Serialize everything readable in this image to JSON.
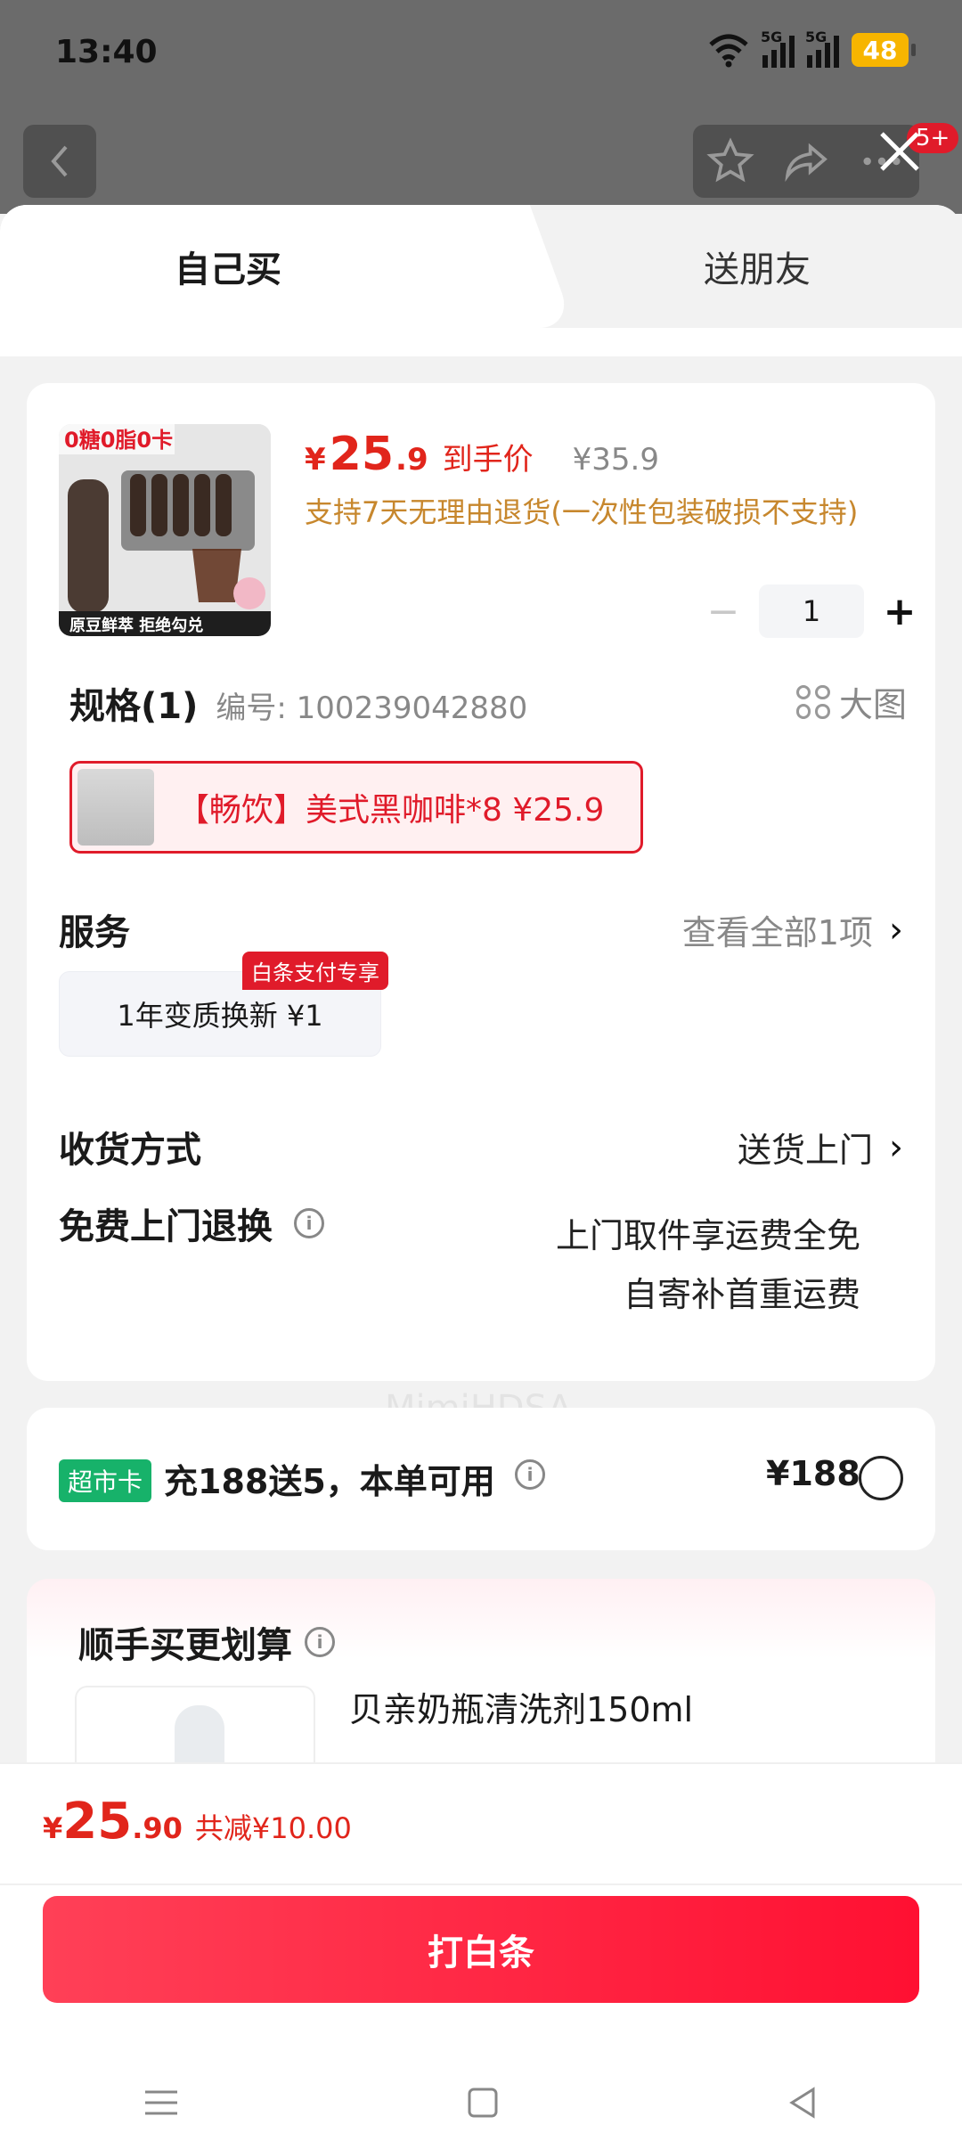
{
  "status": {
    "time": "13:40",
    "signal_1": "5G",
    "signal_2": "5G",
    "battery": "48"
  },
  "topbar": {
    "badge": "5+"
  },
  "tabs": [
    {
      "label": "自己买"
    },
    {
      "label": "送朋友"
    }
  ],
  "product": {
    "currency": "¥",
    "price_int": "25",
    "price_dec": ".9",
    "price_tag": "到手价",
    "original_price": "¥35.9",
    "return_note": "支持7天无理由退货(一次性包装破损不支持)",
    "quantity": "1"
  },
  "spec": {
    "title": "规格(1)",
    "code": "编号: 100239042880",
    "big_image_label": "大图",
    "selected_variant": "【畅饮】美式黑咖啡*8  ¥25.9"
  },
  "service": {
    "title": "服务",
    "view_all": "查看全部1项",
    "option": "1年变质换新  ¥1",
    "badge": "白条支付专享"
  },
  "delivery": {
    "title": "收货方式",
    "value": "送货上门"
  },
  "free_return": {
    "title": "免费上门退换",
    "line1": "上门取件享运费全免",
    "line2": "自寄补首重运费"
  },
  "market_card": {
    "tag": "超市卡",
    "text": "充188送5，本单可用",
    "price": "¥188"
  },
  "add_on": {
    "title": "顺手买更划算",
    "item_name": "贝亲奶瓶清洗剂150ml"
  },
  "watermark": "MimiHDSA",
  "footer": {
    "currency": "¥",
    "total_int": "25",
    "total_dec": ".90",
    "discount": "共减¥10.00",
    "pay_button": "打白条"
  },
  "colors": {
    "accent": "#e1251b",
    "button": "#ff1f3d",
    "market_tag": "#17b26a",
    "note": "#c7872d"
  }
}
